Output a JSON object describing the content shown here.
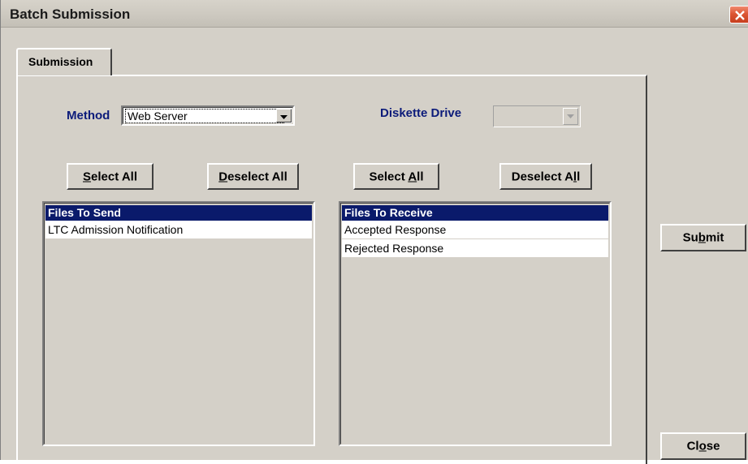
{
  "window": {
    "title": "Batch Submission"
  },
  "tabs": [
    {
      "label": "Submission",
      "selected": true
    }
  ],
  "method": {
    "label": "Method",
    "value": "Web Server"
  },
  "diskette": {
    "label": "Diskette Drive",
    "value": "",
    "enabled": false
  },
  "send_panel": {
    "select_all": {
      "pre": "",
      "key": "S",
      "post": "elect All"
    },
    "deselect_all": {
      "pre": "",
      "key": "D",
      "post": "eselect All"
    },
    "header": "Files To Send",
    "items": [
      "LTC Admission Notification"
    ]
  },
  "receive_panel": {
    "select_all": {
      "pre": "Select ",
      "key": "A",
      "post": "ll"
    },
    "deselect_all": {
      "pre": "Deselect A",
      "key": "l",
      "post": "l"
    },
    "header": "Files To Receive",
    "items": [
      "Accepted Response",
      "Rejected Response"
    ]
  },
  "actions": {
    "submit": {
      "pre": "Su",
      "key": "b",
      "post": "mit"
    },
    "close": {
      "pre": "Cl",
      "key": "o",
      "post": "se"
    }
  },
  "colors": {
    "face": "#d4d0c8",
    "label_blue": "#0c1b7a",
    "list_header_bg": "#0a1a6b",
    "close_red": "#dc5634"
  }
}
